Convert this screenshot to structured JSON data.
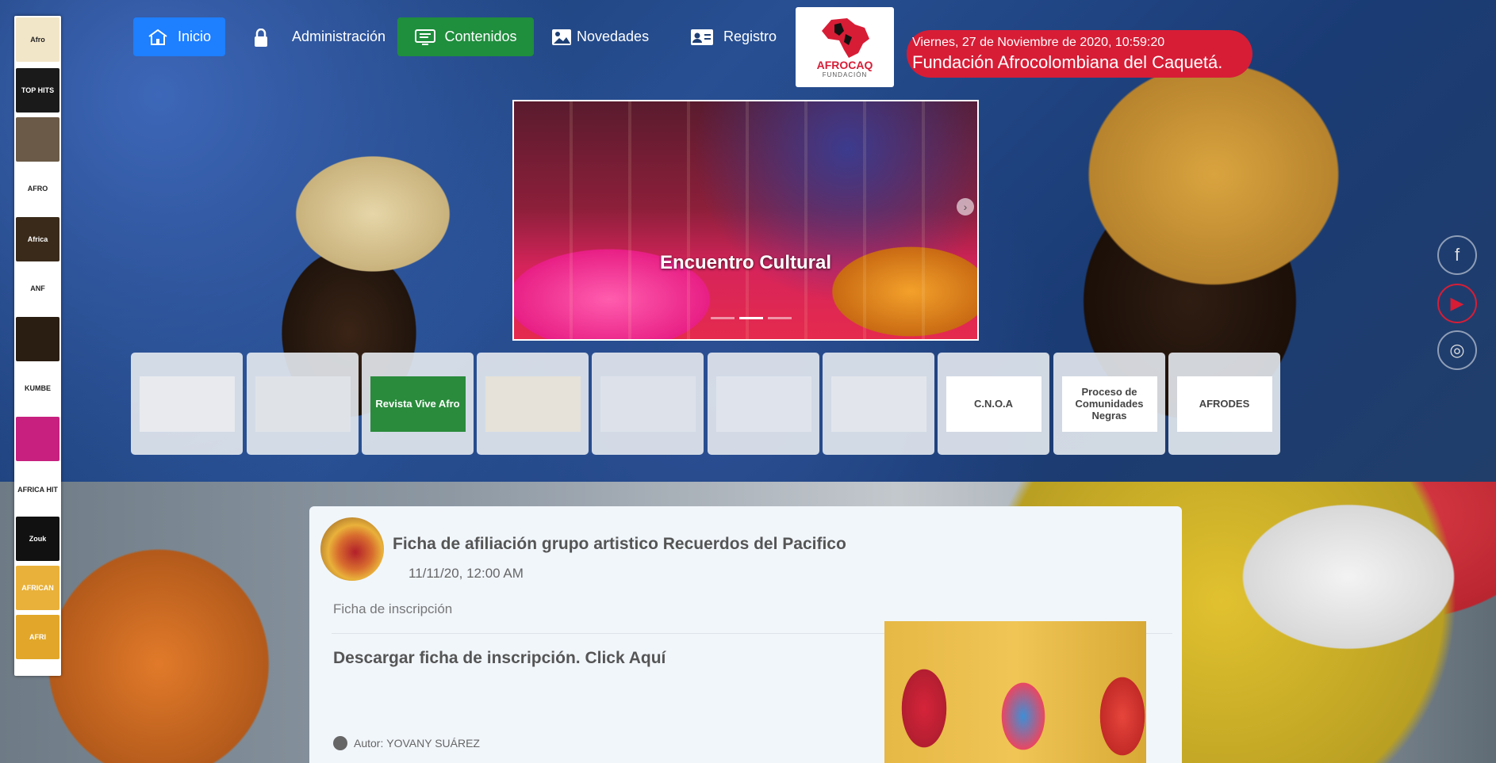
{
  "nav": {
    "inicio": "Inicio",
    "administracion": "Administración",
    "contenidos": "Contenidos",
    "novedades": "Novedades",
    "registro": "Registro"
  },
  "logo": {
    "name": "AFROCAQ",
    "sub": "FUNDACIÓN"
  },
  "header": {
    "datetime": "Viernes, 27 de Noviembre de 2020, 10:59:20",
    "org": "Fundación Afrocolombiana del Caquetá."
  },
  "slider": {
    "caption": "Encuentro Cultural"
  },
  "left_rail": [
    {
      "label": "Afro",
      "color": "#f2e6c8"
    },
    {
      "label": "TOP HITS",
      "color": "#1a1a1a"
    },
    {
      "label": "",
      "color": "#6b5a47"
    },
    {
      "label": "AFRO",
      "color": "#ffffff"
    },
    {
      "label": "Africa",
      "color": "#3a2a1a"
    },
    {
      "label": "ANF",
      "color": "#ffffff"
    },
    {
      "label": "",
      "color": "#2a1d12"
    },
    {
      "label": "KUMBE",
      "color": "#ffffff"
    },
    {
      "label": "",
      "color": "#c7207f"
    },
    {
      "label": "AFRICA HIT",
      "color": "#ffffff"
    },
    {
      "label": "Zouk",
      "color": "#111111"
    },
    {
      "label": "AFRICAN",
      "color": "#e9b13a"
    },
    {
      "label": "AFRI",
      "color": "#e2a72a"
    }
  ],
  "thumbs": [
    {
      "label": "",
      "color": "#e8eaee"
    },
    {
      "label": "",
      "color": "#dfe3e8"
    },
    {
      "label": "Revista Vive Afro",
      "color": "#2a8b3c"
    },
    {
      "label": "",
      "color": "#e6e2d9"
    },
    {
      "label": "",
      "color": "#dde2ea"
    },
    {
      "label": "",
      "color": "#dfe4ec"
    },
    {
      "label": "",
      "color": "#e2e6ec"
    },
    {
      "label": "C.N.O.A",
      "color": "#ffffff"
    },
    {
      "label": "Proceso de Comunidades Negras",
      "color": "#ffffff"
    },
    {
      "label": "AFRODES",
      "color": "#ffffff"
    }
  ],
  "social": {
    "facebook": "f",
    "youtube": "▶",
    "instagram": "◎"
  },
  "post": {
    "title": "Ficha de afiliación grupo artistico Recuerdos del Pacifico",
    "date": "11/11/20, 12:00 AM",
    "subtitle": "Ficha de inscripción",
    "link": "Descargar ficha de inscripción. Click Aquí",
    "author_prefix": "Autor:",
    "author": "YOVANY SUÁREZ"
  }
}
